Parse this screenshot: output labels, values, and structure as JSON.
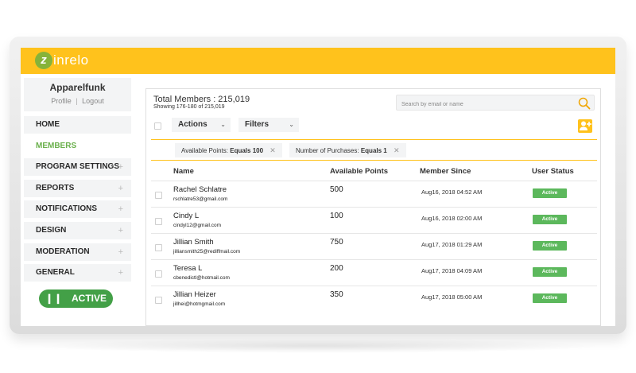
{
  "brand": {
    "logo_mark": "z",
    "logo_text": "inrelo",
    "bar_color": "#ffc21c"
  },
  "account": {
    "name": "Apparelfunk",
    "profile_link": "Profile",
    "separator": "|",
    "logout_link": "Logout"
  },
  "nav": {
    "items": [
      {
        "label": "HOME",
        "expandable": false
      },
      {
        "label": "MEMBERS",
        "expandable": false,
        "active": true
      },
      {
        "label": "PROGRAM SETTINGS",
        "expandable": true
      },
      {
        "label": "REPORTS",
        "expandable": true
      },
      {
        "label": "NOTIFICATIONS",
        "expandable": true
      },
      {
        "label": "DESIGN",
        "expandable": true
      },
      {
        "label": "MODERATION",
        "expandable": true
      },
      {
        "label": "GENERAL",
        "expandable": true
      }
    ],
    "plus": "+",
    "active_color": "#6ab04c"
  },
  "program_status": {
    "label": "ACTIVE",
    "icon": "pause-icon",
    "color": "#43a047"
  },
  "members": {
    "total_label": "Total Members : 215,019",
    "showing_label": "Showing 176-180 of 215,019",
    "search_placeholder": "Search by email or name",
    "actions_label": "Actions",
    "filters_label": "Filters",
    "active_filters": [
      {
        "label": "Available Points:",
        "value": "Equals 100"
      },
      {
        "label": "Number of Purchases:",
        "value": "Equals 1"
      }
    ],
    "columns": [
      "Name",
      "Available Points",
      "Member Since",
      "User Status"
    ],
    "rows": [
      {
        "name": "Rachel Schlatre",
        "email": "rschlatre53@gmail.com",
        "points": "500",
        "since": "Aug16, 2018 04:52 AM",
        "status": "Active"
      },
      {
        "name": "Cindy L",
        "email": "cindyl12@gmail.com",
        "points": "100",
        "since": "Aug16, 2018 02:00 AM",
        "status": "Active"
      },
      {
        "name": "Jillian Smith",
        "email": "jilliansmith25@rediffmail.com",
        "points": "750",
        "since": "Aug17, 2018 01:29 AM",
        "status": "Active"
      },
      {
        "name": "Teresa L",
        "email": "cbenedictl@hotmail.com",
        "points": "200",
        "since": "Aug17, 2018 04:09 AM",
        "status": "Active"
      },
      {
        "name": "Jillian Heizer",
        "email": "jillhei@hotmgmail.com",
        "points": "350",
        "since": "Aug17, 2018 05:00 AM",
        "status": "Active"
      }
    ],
    "status_color": "#5cb85c"
  }
}
